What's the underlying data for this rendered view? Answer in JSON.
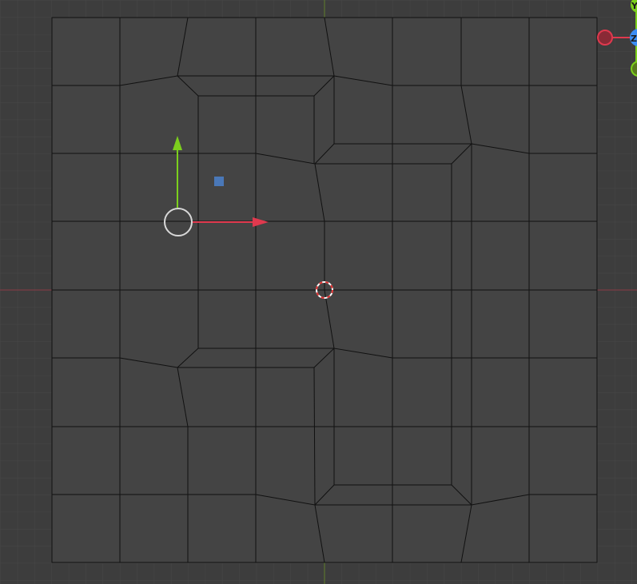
{
  "viewport": {
    "view": "top-orthographic",
    "mode": "edit-mesh"
  },
  "nav_gizmo": {
    "y_label": "Y",
    "z_label": "Z"
  },
  "colors": {
    "background": "#3d3d3d",
    "grid": "#474747",
    "face": "#444444",
    "edge": "#111111",
    "x_axis": "#e0394e",
    "y_axis": "#7ccf1d",
    "z_axis": "#3a8df5",
    "selected_edge": "#f0a030"
  }
}
